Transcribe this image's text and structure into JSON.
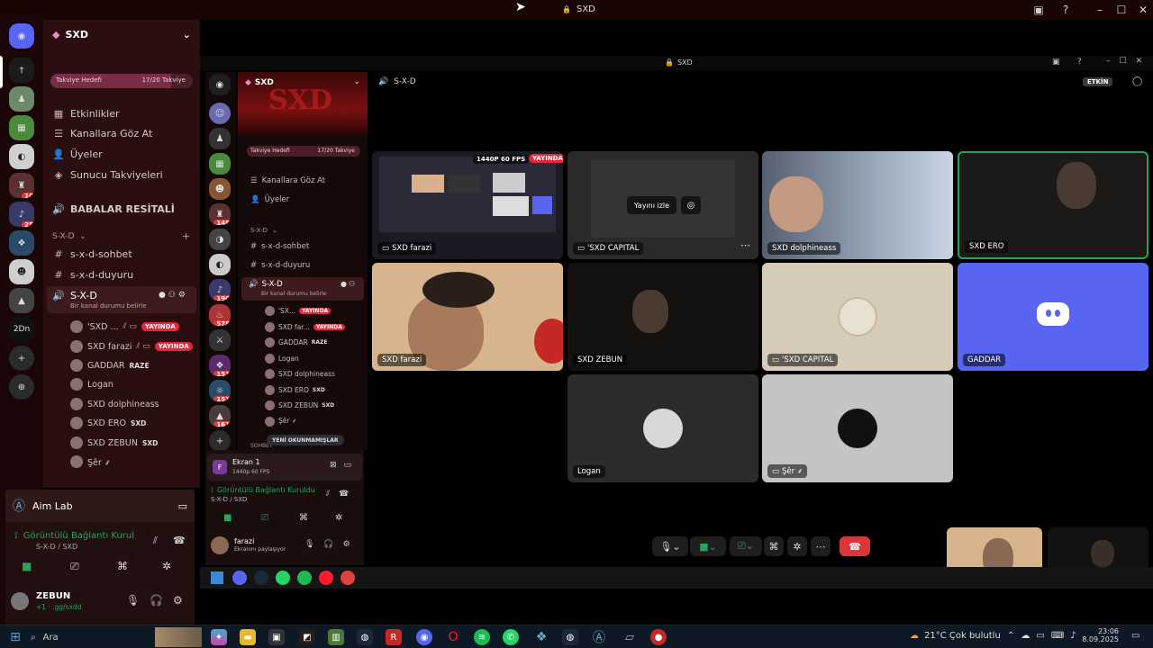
{
  "window": {
    "title": "SXD"
  },
  "inner_window": {
    "title": "SXD",
    "header_channel": "S-X-D",
    "etkin_label": "ETKİN"
  },
  "server": {
    "name": "SXD",
    "boost_goal_label": "Takviye Hedefi",
    "boost_progress": "17/20 Takviye",
    "boost_fraction": 0.85,
    "menu": [
      "Etkinlikler",
      "Kanallara Göz At",
      "Üyeler",
      "Sunucu Takviyeleri"
    ],
    "category_main": "BABALAR RESİTALİ",
    "category_sxd": "S-X-D",
    "text_channels": [
      "s-x-d-sohbet",
      "s-x-d-duyuru"
    ],
    "voice_channel": "S-X-D",
    "voice_status": "Bir kanal durumu belirle",
    "category_sohbet": "SOHBET"
  },
  "voice_users": [
    {
      "name": "'SXD ...",
      "live": true
    },
    {
      "name": "SXD farazi",
      "live": true
    },
    {
      "name": "GADDAR",
      "tag": "RAZE"
    },
    {
      "name": "Logan"
    },
    {
      "name": "SXD dolphineass"
    },
    {
      "name": "SXD ERO",
      "tag": "SXD"
    },
    {
      "name": "SXD ZEBUN",
      "tag": "SXD"
    },
    {
      "name": "Şêr ⸙"
    }
  ],
  "live_label": "YAYINDA",
  "server_badges": [
    "10",
    "25",
    "148",
    "190",
    "578",
    "151",
    "151",
    "161"
  ],
  "server_label_2dn": "2Dn",
  "app_panel": {
    "name": "Aim Lab"
  },
  "voice_panel": {
    "status": "Görüntülü Bağlantı Kurul",
    "channel": "S-X-D / SXD"
  },
  "current_user": {
    "name": "ZEBUN",
    "status": "+1 · .gg/sxdd"
  },
  "inner_server": {
    "menu": [
      "Kanallara Göz At",
      "Üyeler"
    ],
    "category": "S-X-D",
    "text_channels": [
      "s-x-d-sohbet",
      "s-x-d-duyuru"
    ],
    "voice_channel": "S-X-D",
    "voice_status": "Bir kanal durumu belirle",
    "unread_label": "YENİ OKUNMAMIŞLAR",
    "sohbet": "SOHBET",
    "users": [
      "'SX...",
      "SXD far...",
      "GADDAR",
      "Logan",
      "SXD dolphineass",
      "SXD ERO",
      "SXD ZEBUN",
      "Şêr ⸙"
    ],
    "tags": {
      "GADDAR": "RAZE",
      "SXD ERO": "SXD",
      "SXD ZEBUN": "SXD"
    }
  },
  "inner_stream_panel": {
    "title": "Ekran 1",
    "sub": "1440p 60 FPS"
  },
  "inner_voice_panel": {
    "status": "Görüntülü Bağlantı Kuruldu",
    "channel": "S-X-D / SXD"
  },
  "inner_user": {
    "name": "farazi",
    "status": "Ekranını paylaşıyor"
  },
  "tiles": [
    {
      "label": "SXD farazi",
      "type": "screen",
      "quality": "1440P 60 FPS",
      "live": "YAYINDA"
    },
    {
      "label": "'SXD CAPITAL",
      "type": "stream-preview",
      "watch": "Yayını izle"
    },
    {
      "label": "SXD dolphineass",
      "type": "camera"
    },
    {
      "label": "SXD ERO",
      "type": "camera"
    },
    {
      "label": "SXD farazi",
      "type": "camera"
    },
    {
      "label": "SXD ZEBUN",
      "type": "camera"
    },
    {
      "label": "'SXD CAPITAL",
      "type": "avatar"
    },
    {
      "label": "GADDAR",
      "type": "discord"
    },
    {
      "label": "Logan",
      "type": "avatar"
    },
    {
      "label": "Şêr ⸙",
      "type": "avatar"
    }
  ],
  "taskbar": {
    "search": "Ara",
    "weather": "21°C  Çok bulutlu",
    "time": "23:06",
    "date": "8.09.2025"
  },
  "colors": {
    "live": "#e5263d",
    "discord": "#5865f2",
    "accent_green": "#23a55a",
    "hangup": "#da373c"
  }
}
